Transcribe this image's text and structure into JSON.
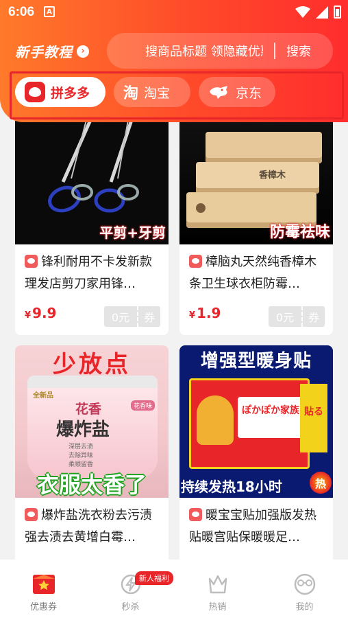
{
  "status_bar": {
    "time": "6:06",
    "notification_icon": "A"
  },
  "header": {
    "tutorial_label": "新手教程",
    "search_placeholder": "搜商品标题 领隐藏优惠券",
    "search_button": "搜索"
  },
  "platforms": [
    {
      "label": "拼多多",
      "icon": "pdd-logo",
      "selected": true
    },
    {
      "label": "淘宝",
      "icon": "taobao-logo",
      "selected": false
    },
    {
      "label": "京东",
      "icon": "jd-logo",
      "selected": false
    }
  ],
  "products": [
    {
      "title": "锋利耐用不卡发新款理发店剪刀家用锋…",
      "price_symbol": "¥",
      "price": "9.9",
      "coupon_amount": "0元",
      "coupon_label": "券",
      "image_caption": "平剪+牙剪"
    },
    {
      "title": "樟脑丸天然纯香樟木条卫生球衣柜防霉…",
      "price_symbol": "¥",
      "price": "1.9",
      "coupon_amount": "0元",
      "coupon_label": "券",
      "image_caption": "防霉祛味",
      "image_block_text": "香樟木"
    },
    {
      "title": "爆炸盐洗衣粉去污渍强去渍去黄增白霉…",
      "image_top": "少放点",
      "image_bottom": "衣服太香了",
      "image_brand": "全新品",
      "image_product": "爆炸盐",
      "image_flower": "花香",
      "image_tag": "花香味",
      "image_features": [
        "深层去渍",
        "去除异味",
        "柔顺留香"
      ]
    },
    {
      "title": "暖宝宝贴加强版发热贴暖宫贴保暖暖足…",
      "image_top": "增强型暖身贴",
      "image_bottom": "持续发热18小时",
      "image_hot": "热",
      "image_box_brand": "ぽかぽか家族",
      "image_box_side": "貼る"
    }
  ],
  "bottom_nav": [
    {
      "label": "优惠券",
      "icon": "coupon-icon",
      "active": true
    },
    {
      "label": "秒杀",
      "icon": "flash-sale-icon",
      "active": false,
      "badge": "新人福利"
    },
    {
      "label": "热销",
      "icon": "hot-sale-icon",
      "active": false
    },
    {
      "label": "我的",
      "icon": "profile-icon",
      "active": false
    }
  ],
  "colors": {
    "brand_red": "#e8262a",
    "header_orange": "#ff7a2a"
  }
}
